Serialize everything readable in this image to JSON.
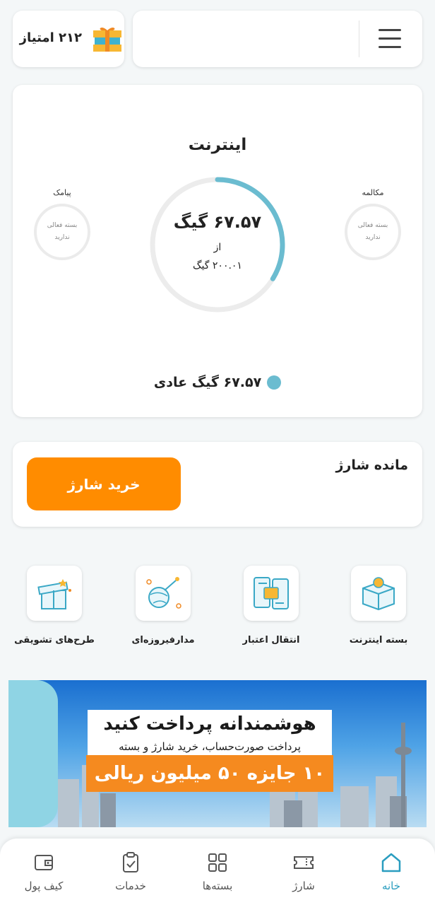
{
  "header": {
    "points_text": "۲۱۲ امتیاز",
    "phone_number": ""
  },
  "usage": {
    "title": "اینترنت",
    "left_label": "پیامک",
    "left_status": "بسته فعالی ندارید",
    "right_label": "مکالمه",
    "right_status": "بسته فعالی ندارید",
    "remaining": "۶۷.۵۷ گیگ",
    "of_text": "از",
    "total": "۲۰۰.۰۱ گیگ",
    "remaining_fraction": 0.3378,
    "legend": "۶۷.۵۷ گیگ عادی"
  },
  "charge": {
    "label": "مانده شارژ",
    "buy_button": "خرید شارژ"
  },
  "services": [
    {
      "label": "بسته اینترنت",
      "icon": "internet-package-icon"
    },
    {
      "label": "انتقال اعتبار",
      "icon": "credit-transfer-icon"
    },
    {
      "label": "مدارفیروزه‌ای",
      "icon": "turquoise-orbit-icon"
    },
    {
      "label": "طرح‌های تشویقی",
      "icon": "gift-box-icon"
    }
  ],
  "banner": {
    "line1": "هوشمندانه پرداخت کنید",
    "line2": "پرداخت صورت‌حساب، خرید شارژ و بسته",
    "line3": "۱۰ جایزه ۵۰ میلیون ریالی"
  },
  "nav": [
    {
      "label": "خانه",
      "icon": "home-icon",
      "active": true
    },
    {
      "label": "شارژ",
      "icon": "ticket-icon",
      "active": false
    },
    {
      "label": "بسته‌ها",
      "icon": "grid-icon",
      "active": false
    },
    {
      "label": "خدمات",
      "icon": "clipboard-icon",
      "active": false
    },
    {
      "label": "کیف پول",
      "icon": "wallet-icon",
      "active": false
    }
  ],
  "colors": {
    "accent": "#6bbcd0",
    "orange": "#ff8c00",
    "nav_active": "#2a9dbf"
  }
}
